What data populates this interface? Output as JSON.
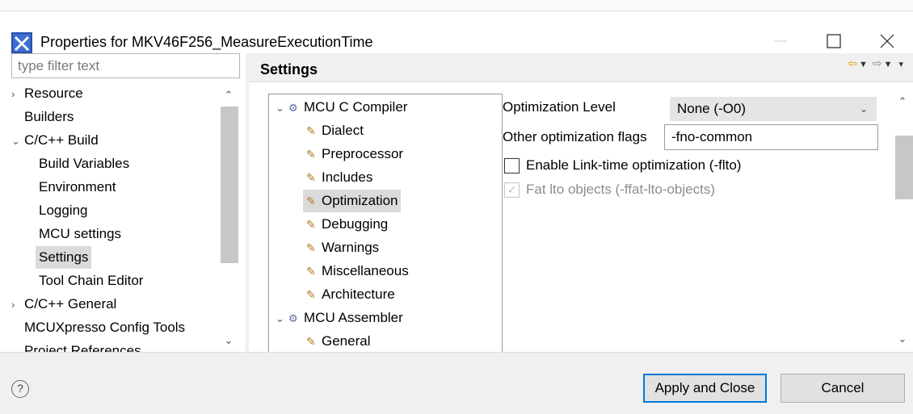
{
  "window": {
    "title": "Properties for MKV46F256_MeasureExecutionTime",
    "app_icon": "x-logo-icon",
    "controls": [
      "minimize-icon",
      "maximize-icon",
      "close-icon"
    ]
  },
  "filter": {
    "placeholder": "type filter text",
    "value": ""
  },
  "left_tree": {
    "items": [
      {
        "label": "Resource",
        "twisty": "›",
        "indent": 0
      },
      {
        "label": "Builders",
        "twisty": "",
        "indent": 0
      },
      {
        "label": "C/C++ Build",
        "twisty": "⌄",
        "indent": 0
      },
      {
        "label": "Build Variables",
        "twisty": "",
        "indent": 1
      },
      {
        "label": "Environment",
        "twisty": "",
        "indent": 1
      },
      {
        "label": "Logging",
        "twisty": "",
        "indent": 1
      },
      {
        "label": "MCU settings",
        "twisty": "",
        "indent": 1
      },
      {
        "label": "Settings",
        "twisty": "",
        "indent": 1,
        "selected": true
      },
      {
        "label": "Tool Chain Editor",
        "twisty": "",
        "indent": 1
      },
      {
        "label": "C/C++ General",
        "twisty": "›",
        "indent": 0
      },
      {
        "label": "MCUXpresso Config Tools",
        "twisty": "",
        "indent": 0
      },
      {
        "label": "Project References",
        "twisty": "",
        "indent": 0
      }
    ]
  },
  "settings": {
    "title": "Settings",
    "nav_icons": [
      "back-arrow-icon",
      "forward-arrow-icon",
      "view-menu-icon"
    ]
  },
  "tool_tree": {
    "items": [
      {
        "label": "MCU C Compiler",
        "type": "tool",
        "indent": 0
      },
      {
        "label": "Dialect",
        "type": "option",
        "indent": 1
      },
      {
        "label": "Preprocessor",
        "type": "option",
        "indent": 1
      },
      {
        "label": "Includes",
        "type": "option",
        "indent": 1
      },
      {
        "label": "Optimization",
        "type": "option",
        "indent": 1,
        "selected": true
      },
      {
        "label": "Debugging",
        "type": "option",
        "indent": 1
      },
      {
        "label": "Warnings",
        "type": "option",
        "indent": 1
      },
      {
        "label": "Miscellaneous",
        "type": "option",
        "indent": 1
      },
      {
        "label": "Architecture",
        "type": "option",
        "indent": 1
      },
      {
        "label": "MCU Assembler",
        "type": "tool",
        "indent": 0
      },
      {
        "label": "General",
        "type": "option",
        "indent": 1
      }
    ]
  },
  "optimization": {
    "level_label": "Optimization Level",
    "level_value": "None (-O0)",
    "flags_label": "Other optimization flags",
    "flags_value": "-fno-common",
    "lto_label": "Enable Link-time optimization (-flto)",
    "lto_checked": false,
    "fat_lto_label": "Fat lto objects (-ffat-lto-objects)",
    "fat_lto_checked": true,
    "fat_lto_enabled": false
  },
  "footer": {
    "apply_close": "Apply and Close",
    "cancel": "Cancel"
  }
}
